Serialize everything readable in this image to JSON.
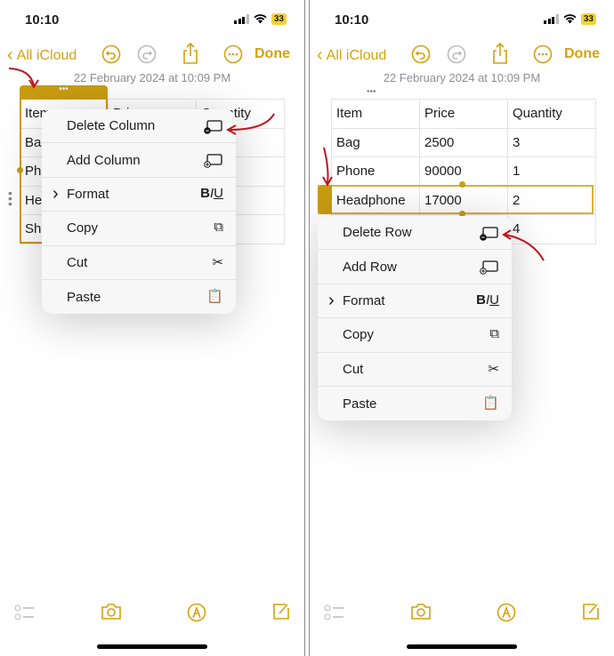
{
  "accent": "#d4a20f",
  "status": {
    "time": "10:10",
    "battery": "33"
  },
  "nav": {
    "back_label": "All iCloud",
    "done_label": "Done"
  },
  "note": {
    "date": "22 February 2024 at 10:09 PM"
  },
  "left": {
    "table": [
      [
        "Item",
        "Pri",
        "Quantity"
      ],
      [
        "Bag",
        "",
        ""
      ],
      [
        "Phone",
        "",
        ""
      ],
      [
        "Headphone",
        "",
        ""
      ],
      [
        "Sho",
        "",
        ""
      ]
    ],
    "menu": [
      {
        "label": "Delete Column",
        "icon": "delete-column-icon",
        "glyph": "▭"
      },
      {
        "label": "Add Column",
        "icon": "add-column-icon",
        "glyph": "▭"
      },
      {
        "label": "Format",
        "icon": "format-biu-icon",
        "glyph": "BIU",
        "submenu": true
      },
      {
        "label": "Copy",
        "icon": "copy-icon",
        "glyph": "⧉"
      },
      {
        "label": "Cut",
        "icon": "scissors-icon",
        "glyph": "✂"
      },
      {
        "label": "Paste",
        "icon": "paste-icon",
        "glyph": "📋"
      }
    ]
  },
  "right": {
    "table": [
      [
        "Item",
        "Price",
        "Quantity"
      ],
      [
        "Bag",
        "2500",
        "3"
      ],
      [
        "Phone",
        "90000",
        "1"
      ],
      [
        "Headphone",
        "17000",
        "2"
      ],
      [
        "",
        "",
        "4"
      ]
    ],
    "menu": [
      {
        "label": "Delete Row",
        "icon": "delete-row-icon",
        "glyph": "▭"
      },
      {
        "label": "Add Row",
        "icon": "add-row-icon",
        "glyph": "▭"
      },
      {
        "label": "Format",
        "icon": "format-biu-icon",
        "glyph": "BIU",
        "submenu": true
      },
      {
        "label": "Copy",
        "icon": "copy-icon",
        "glyph": "⧉"
      },
      {
        "label": "Cut",
        "icon": "scissors-icon",
        "glyph": "✂"
      },
      {
        "label": "Paste",
        "icon": "paste-icon",
        "glyph": "📋"
      }
    ]
  }
}
